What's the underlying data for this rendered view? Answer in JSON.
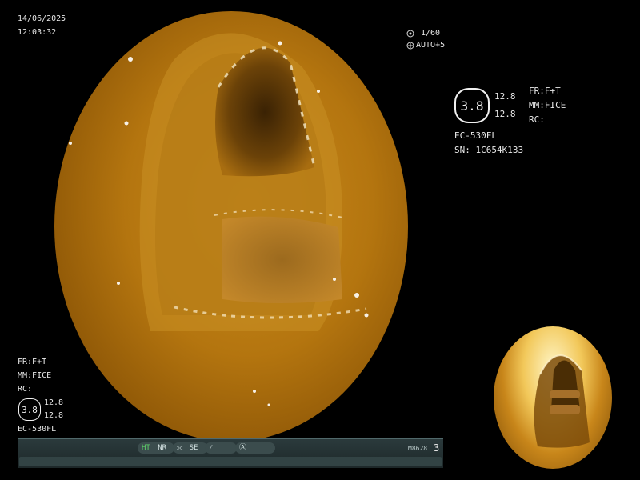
{
  "overlay_top_left": {
    "date": "14/06/2025",
    "time": "12:03:32"
  },
  "overlay_top_center": {
    "shutter": "1/60",
    "iris": "AUTO+5"
  },
  "right_panel": {
    "zoom_value": "3.8",
    "zoom_top": "12.8",
    "zoom_bottom": "12.8",
    "fr": "FR:F+T",
    "mm": "MM:FICE",
    "rc": "RC:",
    "scope_model": "EC-530FL",
    "serial": "SN: 1C654K133"
  },
  "left_panel": {
    "fr": "FR:F+T",
    "mm": "MM:FICE",
    "rc": "RC:",
    "zoom_value": "3.8",
    "zoom_top": "12.8",
    "zoom_bottom": "12.8",
    "scope_model": "EC-530FL"
  },
  "status_bar": {
    "ht_label": "HT",
    "nr_label": "NR",
    "se_label": "SE",
    "code": "M8628",
    "number": "3"
  },
  "colors": {
    "overlay_text": "#e8e8e8",
    "ht_active": "#5fd36a",
    "status_bar_bg": "#2b3a3c"
  },
  "icons": [
    "shutter-icon",
    "iris-icon",
    "edge-enhance-icon",
    "brightness-icon",
    "record-icon"
  ]
}
